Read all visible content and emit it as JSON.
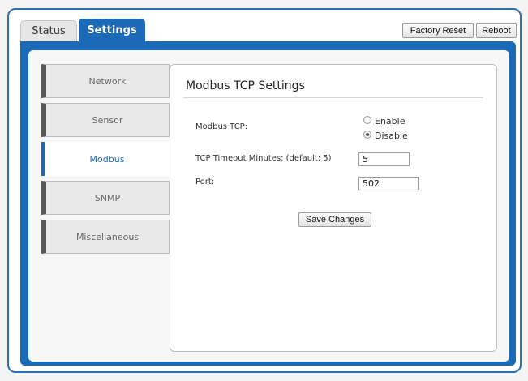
{
  "tabs": [
    {
      "label": "Status",
      "active": false
    },
    {
      "label": "Settings",
      "active": true
    }
  ],
  "toolbar": {
    "factory_reset_label": "Factory Reset",
    "reboot_label": "Reboot"
  },
  "sidebar": {
    "items": [
      {
        "label": "Network",
        "active": false
      },
      {
        "label": "Sensor",
        "active": false
      },
      {
        "label": "Modbus",
        "active": true
      },
      {
        "label": "SNMP",
        "active": false
      },
      {
        "label": "Miscellaneous",
        "active": false
      }
    ]
  },
  "panel": {
    "title": "Modbus TCP Settings",
    "modbus_tcp": {
      "label": "Modbus TCP:",
      "options": [
        {
          "label": "Enable",
          "checked": false
        },
        {
          "label": "Disable",
          "checked": true
        }
      ]
    },
    "timeout": {
      "label": "TCP Timeout Minutes: (default: 5)",
      "value": "5"
    },
    "port": {
      "label": "Port:",
      "value": "502"
    },
    "save_label": "Save Changes"
  },
  "colors": {
    "accent": "#1b6ab8",
    "sidebar_marker": "#585858"
  }
}
